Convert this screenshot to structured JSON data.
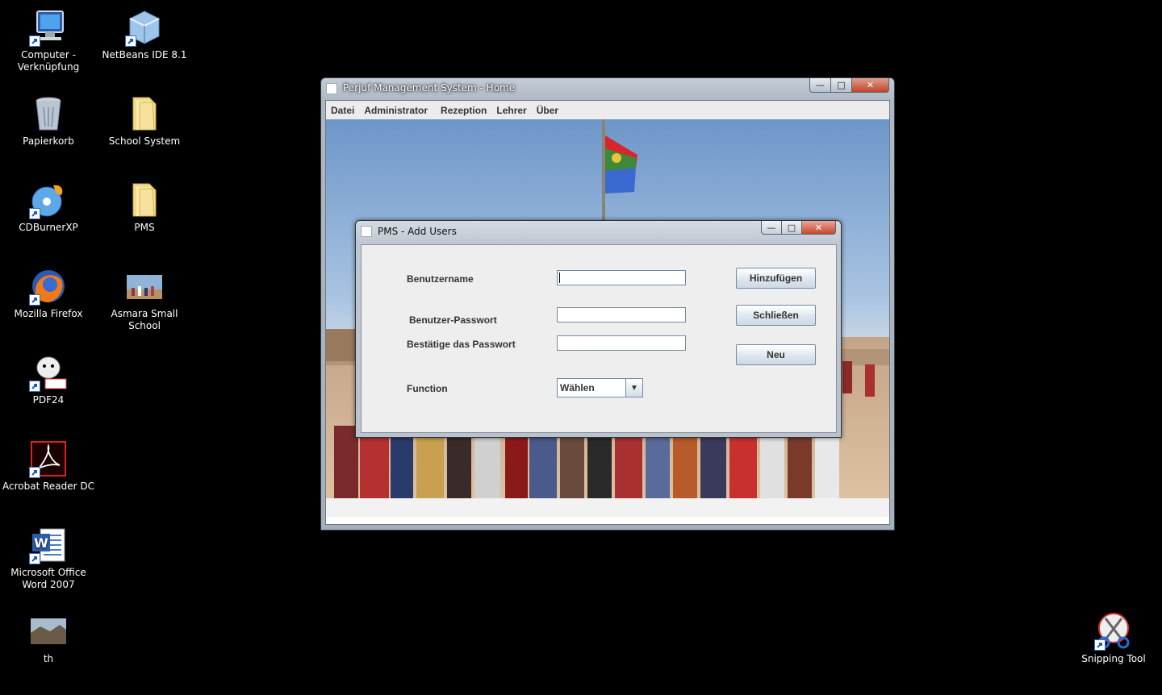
{
  "desktop": {
    "icons": [
      {
        "label": "Computer -\nVerknüpfung",
        "icon": "computer-icon"
      },
      {
        "label": "NetBeans IDE 8.1",
        "icon": "netbeans-icon"
      },
      {
        "label": "Papierkorb",
        "icon": "recycle-bin-icon"
      },
      {
        "label": "School System",
        "icon": "folder-icon"
      },
      {
        "label": "CDBurnerXP",
        "icon": "cdburner-icon"
      },
      {
        "label": "PMS",
        "icon": "folder-icon"
      },
      {
        "label": "Mozilla Firefox",
        "icon": "firefox-icon"
      },
      {
        "label": "Asmara Small School",
        "icon": "photo-icon"
      },
      {
        "label": "PDF24",
        "icon": "pdf24-icon"
      },
      {
        "label": "Acrobat Reader DC",
        "icon": "acrobat-icon"
      },
      {
        "label": "Microsoft Office\nWord 2007",
        "icon": "word-icon"
      },
      {
        "label": "th",
        "icon": "image-icon"
      },
      {
        "label": "Snipping Tool",
        "icon": "snipping-tool-icon"
      }
    ]
  },
  "main_window": {
    "title": "Perjuf Management System - Home",
    "menu": [
      "Datei",
      "Administrator",
      "Rezeption",
      "Lehrer",
      "Über"
    ]
  },
  "dialog": {
    "title": "PMS - Add Users",
    "labels": {
      "username": "Benutzername",
      "password": "Benutzer-Passwort",
      "confirm": "Bestätige das Passwort",
      "function": "Function"
    },
    "values": {
      "username": "",
      "password": "",
      "confirm": ""
    },
    "buttons": {
      "add": "Hinzufügen",
      "close": "Schließen",
      "new": "Neu"
    },
    "function_select": "Wählen"
  },
  "colors": {
    "desktop": "#000000",
    "close_button": "#c8462c",
    "panel": "#eeeeee"
  }
}
